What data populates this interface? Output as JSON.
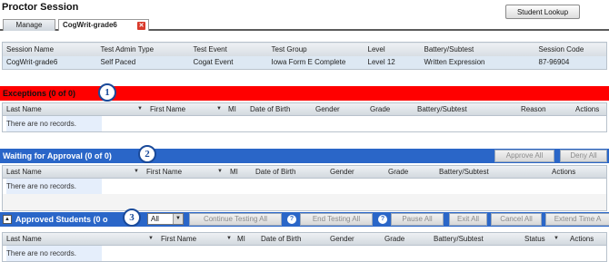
{
  "title": "Proctor Session",
  "student_lookup": "Student Lookup",
  "tabs": {
    "manage": "Manage",
    "active": "CogWrit-grade6",
    "close": "✕"
  },
  "session": {
    "headers": [
      "Session Name",
      "Test Admin Type",
      "Test Event",
      "Test Group",
      "Level",
      "Battery/Subtest",
      "Session Code"
    ],
    "values": [
      "CogWrit-grade6",
      "Self Paced",
      "Cogat Event",
      "Iowa Form E Complete",
      "Level 12",
      "Written Expression",
      "87-96904"
    ]
  },
  "exceptions": {
    "label": "Exceptions  (0 of 0)",
    "badge": "1",
    "headers": [
      "Last Name",
      "First Name",
      "MI",
      "Date of Birth",
      "Gender",
      "Grade",
      "Battery/Subtest",
      "Reason",
      "Actions"
    ],
    "no_records": "There are no records."
  },
  "waiting": {
    "label": "Waiting for Approval (0 of 0)",
    "badge": "2",
    "approve_all": "Approve All",
    "deny_all": "Deny All",
    "headers": [
      "Last Name",
      "First Name",
      "MI",
      "Date of Birth",
      "Gender",
      "Grade",
      "Battery/Subtest",
      "Actions"
    ],
    "no_records": "There are no records."
  },
  "approved": {
    "label": "Approved Students (0 o",
    "badge": "3",
    "collapse": "▲",
    "filter_value": "All",
    "continue_testing_all": "Continue Testing All",
    "end_testing_all": "End Testing All",
    "pause_all": "Pause All",
    "exit_all": "Exit All",
    "cancel_all": "Cancel All",
    "extend_time": "Extend Time A",
    "help": "?",
    "headers": [
      "Last Name",
      "First Name",
      "MI",
      "Date of Birth",
      "Gender",
      "Grade",
      "Battery/Subtest",
      "Status",
      "Actions"
    ],
    "no_records": "There are no records."
  },
  "icons": {
    "sort_arrow": "▼"
  },
  "colors": {
    "exceptions_bar": "#ff0000",
    "section_bar": "#2a66c8"
  }
}
